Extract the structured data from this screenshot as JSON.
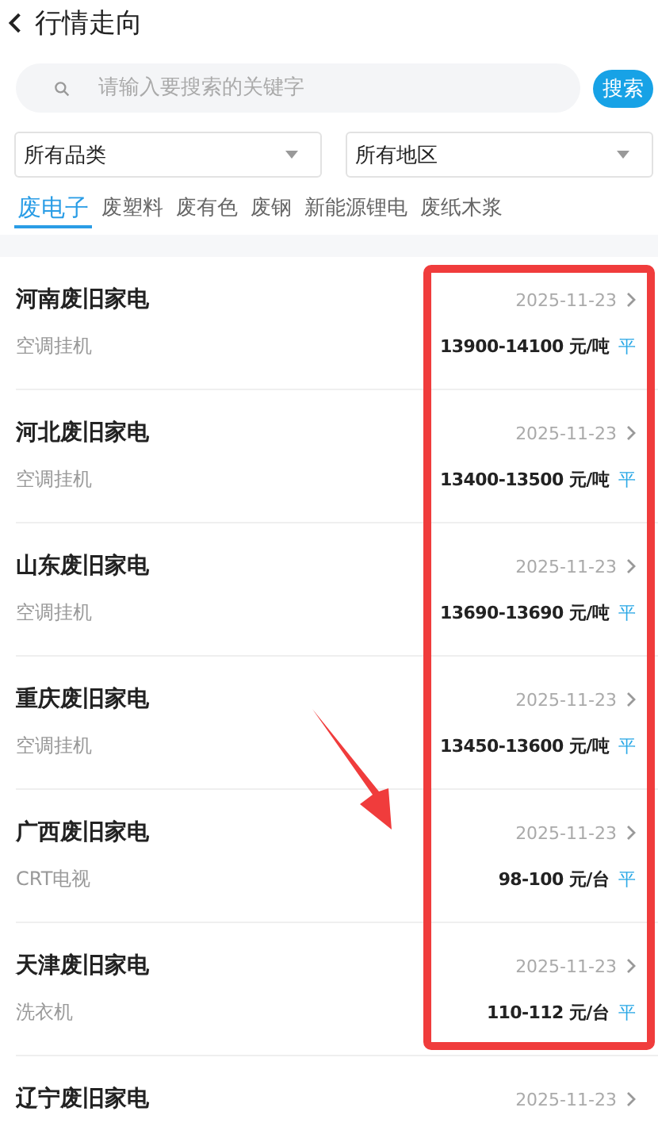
{
  "header": {
    "title": "行情走向"
  },
  "search": {
    "placeholder": "请输入要搜索的关键字",
    "button": "搜索"
  },
  "filters": [
    {
      "value": "所有品类"
    },
    {
      "value": "所有地区"
    }
  ],
  "tabs": [
    {
      "label": "废电子",
      "selected": true
    },
    {
      "label": "废塑料",
      "selected": false
    },
    {
      "label": "废有色",
      "selected": false
    },
    {
      "label": "废钢",
      "selected": false
    },
    {
      "label": "新能源锂电",
      "selected": false
    },
    {
      "label": "废纸木浆",
      "selected": false
    }
  ],
  "items": [
    {
      "name": "河南废旧家电",
      "category": "空调挂机",
      "date": "2025-11-23",
      "price": "13900-14100 元/吨",
      "trend": "平"
    },
    {
      "name": "河北废旧家电",
      "category": "空调挂机",
      "date": "2025-11-23",
      "price": "13400-13500 元/吨",
      "trend": "平"
    },
    {
      "name": "山东废旧家电",
      "category": "空调挂机",
      "date": "2025-11-23",
      "price": "13690-13690 元/吨",
      "trend": "平"
    },
    {
      "name": "重庆废旧家电",
      "category": "空调挂机",
      "date": "2025-11-23",
      "price": "13450-13600 元/吨",
      "trend": "平"
    },
    {
      "name": "广西废旧家电",
      "category": "CRT电视",
      "date": "2025-11-23",
      "price": "98-100 元/台",
      "trend": "平"
    },
    {
      "name": "天津废旧家电",
      "category": "洗衣机",
      "date": "2025-11-23",
      "price": "110-112 元/台",
      "trend": "平"
    },
    {
      "name": "辽宁废旧家电",
      "date": "2025-11-23"
    }
  ]
}
